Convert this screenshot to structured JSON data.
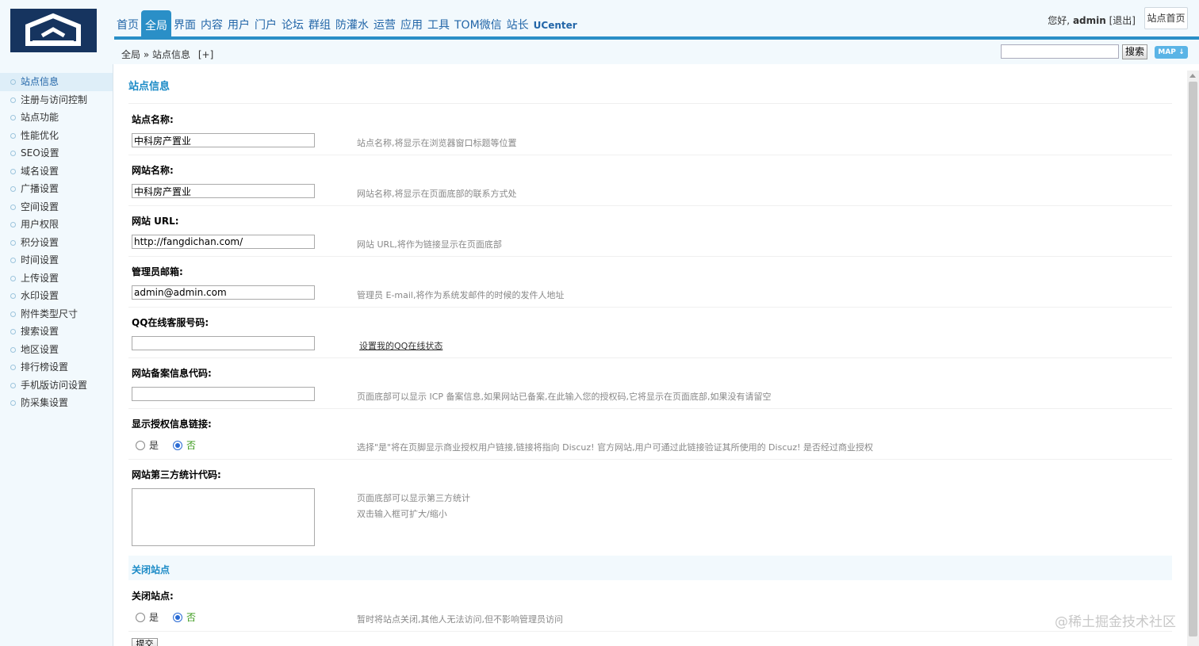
{
  "nav": {
    "items": [
      "首页",
      "全局",
      "界面",
      "内容",
      "用户",
      "门户",
      "论坛",
      "群组",
      "防灌水",
      "运营",
      "应用",
      "工具",
      "TOM微信",
      "站长",
      "UCenter"
    ],
    "active_index": 1
  },
  "user": {
    "greeting": "您好,",
    "name": "admin",
    "logout": "[退出]",
    "home_button": "站点首页"
  },
  "breadcrumb": {
    "section": "全局",
    "separator": "»",
    "page": "站点信息",
    "add": "[+]"
  },
  "search": {
    "value": "",
    "button": "搜索",
    "map": "MAP"
  },
  "sidebar": {
    "items": [
      "站点信息",
      "注册与访问控制",
      "站点功能",
      "性能优化",
      "SEO设置",
      "域名设置",
      "广播设置",
      "空间设置",
      "用户权限",
      "积分设置",
      "时间设置",
      "上传设置",
      "水印设置",
      "附件类型尺寸",
      "搜索设置",
      "地区设置",
      "排行榜设置",
      "手机版访问设置",
      "防采集设置"
    ],
    "active_index": 0
  },
  "page": {
    "title": "站点信息"
  },
  "form": {
    "site_name": {
      "label": "站点名称:",
      "value": "中科房产置业",
      "tip": "站点名称,将显示在浏览器窗口标题等位置"
    },
    "web_name": {
      "label": "网站名称:",
      "value": "中科房产置业",
      "tip": "网站名称,将显示在页面底部的联系方式处"
    },
    "web_url": {
      "label": "网站 URL:",
      "value": "http://fangdichan.com/",
      "tip": "网站 URL,将作为链接显示在页面底部"
    },
    "admin_email": {
      "label": "管理员邮箱:",
      "value": "admin@admin.com",
      "tip": "管理员 E-mail,将作为系统发邮件的时候的发件人地址"
    },
    "qq": {
      "label": "QQ在线客服号码:",
      "value": "",
      "link": "设置我的QQ在线状态"
    },
    "icp": {
      "label": "网站备案信息代码:",
      "value": "",
      "tip": "页面底部可以显示 ICP 备案信息,如果网站已备案,在此输入您的授权码,它将显示在页面底部,如果没有请留空"
    },
    "license_link": {
      "label": "显示授权信息链接:",
      "yes": "是",
      "no": "否",
      "selected": "no",
      "tip": "选择\"是\"将在页脚显示商业授权用户链接,链接将指向 Discuz! 官方网站,用户可通过此链接验证其所使用的 Discuz! 是否经过商业授权"
    },
    "stat_code": {
      "label": "网站第三方统计代码:",
      "value": "",
      "tip1": "页面底部可以显示第三方统计",
      "tip2": "双击输入框可扩大/缩小"
    }
  },
  "close_section": {
    "title": "关闭站点",
    "label": "关闭站点:",
    "yes": "是",
    "no": "否",
    "selected": "no",
    "tip": "暂时将站点关闭,其他人无法访问,但不影响管理员访问"
  },
  "submit": "提交",
  "watermark": "@稀土掘金技术社区",
  "colors": {
    "accent": "#2a8fc7",
    "title": "#1a8ac6",
    "bg_light": "#f2f9fd"
  }
}
